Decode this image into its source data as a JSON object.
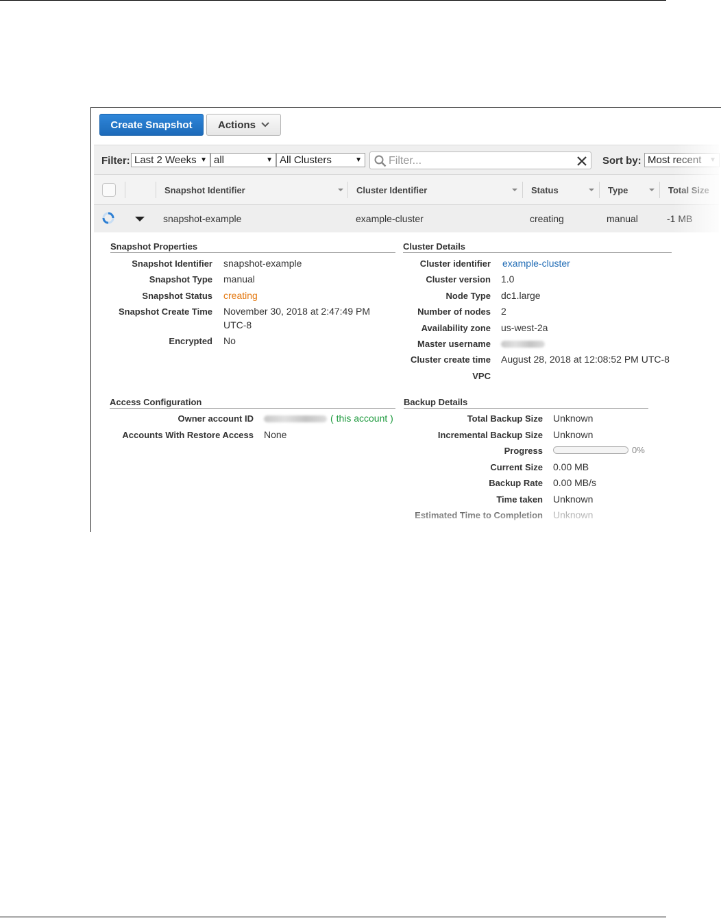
{
  "toolbar": {
    "create_label": "Create Snapshot",
    "actions_label": "Actions"
  },
  "filter": {
    "label": "Filter:",
    "range_value": "Last 2 Weeks",
    "type_value": "all",
    "cluster_value": "All Clusters",
    "search_placeholder": "Filter...",
    "sort_label": "Sort by:",
    "sort_value": "Most recent"
  },
  "table": {
    "columns": [
      "Snapshot Identifier",
      "Cluster Identifier",
      "Status",
      "Type",
      "Total Size"
    ],
    "rows": [
      {
        "snapshot_identifier": "snapshot-example",
        "cluster_identifier": "example-cluster",
        "status": "creating",
        "type": "manual",
        "total_size": "-1 MB"
      }
    ]
  },
  "snapshot_properties": {
    "title": "Snapshot Properties",
    "identifier_label": "Snapshot Identifier",
    "identifier_value": "snapshot-example",
    "type_label": "Snapshot Type",
    "type_value": "manual",
    "status_label": "Snapshot Status",
    "status_value": "creating",
    "create_time_label": "Snapshot Create Time",
    "create_time_line1": "November 30, 2018 at 2:47:49 PM",
    "create_time_line2": "UTC-8",
    "encrypted_label": "Encrypted",
    "encrypted_value": "No"
  },
  "cluster_details": {
    "title": "Cluster Details",
    "identifier_label": "Cluster identifier",
    "identifier_value": "example-cluster",
    "version_label": "Cluster version",
    "version_value": "1.0",
    "node_type_label": "Node Type",
    "node_type_value": "dc1.large",
    "nodes_label": "Number of nodes",
    "nodes_value": "2",
    "az_label": "Availability zone",
    "az_value": "us-west-2a",
    "master_label": "Master username",
    "create_time_label": "Cluster create time",
    "create_time_value": "August 28, 2018 at 12:08:52 PM UTC-8",
    "vpc_label": "VPC"
  },
  "access_configuration": {
    "title": "Access Configuration",
    "owner_label": "Owner account ID",
    "owner_link_open": "(",
    "owner_link": "this account",
    "owner_link_close": ")",
    "restore_label": "Accounts With Restore Access",
    "restore_value": "None"
  },
  "backup_details": {
    "title": "Backup Details",
    "total_label": "Total Backup Size",
    "total_value": "Unknown",
    "incremental_label": "Incremental Backup Size",
    "incremental_value": "Unknown",
    "progress_label": "Progress",
    "progress_percent": 0,
    "progress_text": "0%",
    "current_label": "Current Size",
    "current_value": "0.00 MB",
    "rate_label": "Backup Rate",
    "rate_value": "0.00 MB/s",
    "time_label": "Time taken",
    "time_value": "Unknown",
    "eta_label": "Estimated Time to Completion",
    "eta_value": "Unknown"
  },
  "colors": {
    "primary_button": "#1c6ab9",
    "status_creating": "#e47911",
    "link": "#1f6bb5",
    "account_link": "#1e9a3e"
  }
}
